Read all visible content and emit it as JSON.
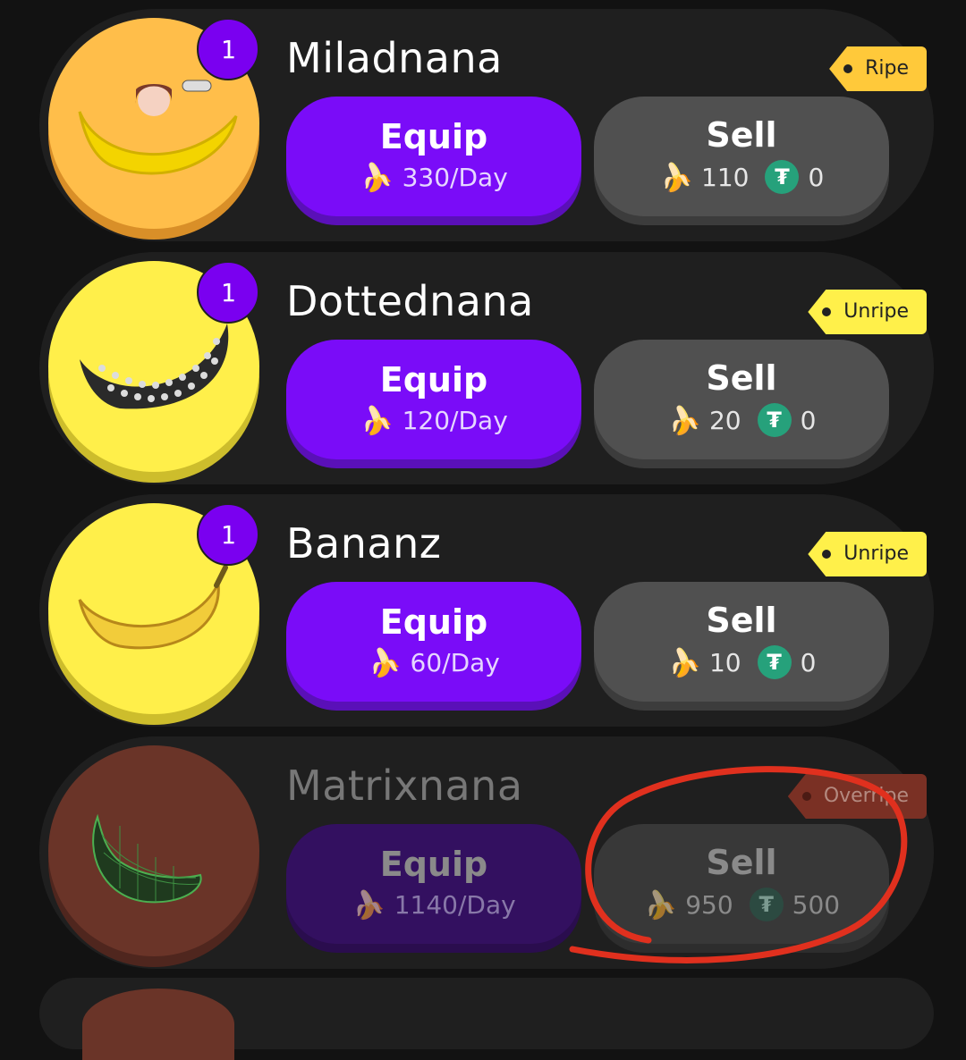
{
  "accent": {
    "equip": "#7a0cf8",
    "sell": "#505050",
    "usdt": "#26a17b"
  },
  "cards": [
    {
      "name": "Miladnana",
      "count": "1",
      "tag": "Ripe",
      "equip": "Equip",
      "rate": "330/Day",
      "sell": "Sell",
      "banana": "110",
      "usdt": "0",
      "icon": "banana-icon",
      "disc": "#ffbe4a"
    },
    {
      "name": "Dottednana",
      "count": "1",
      "tag": "Unripe",
      "equip": "Equip",
      "rate": "120/Day",
      "sell": "Sell",
      "banana": "20",
      "usdt": "0",
      "icon": "banana-icon",
      "disc": "#ffef4a"
    },
    {
      "name": "Bananz",
      "count": "1",
      "tag": "Unripe",
      "equip": "Equip",
      "rate": "60/Day",
      "sell": "Sell",
      "banana": "10",
      "usdt": "0",
      "icon": "banana-icon",
      "disc": "#ffef4a"
    },
    {
      "name": "Matrixnana",
      "tag": "Overripe",
      "equip": "Equip",
      "rate": "1140/Day",
      "sell": "Sell",
      "banana": "950",
      "usdt": "500",
      "icon": "banana-icon",
      "disc": "#6a3428"
    }
  ]
}
